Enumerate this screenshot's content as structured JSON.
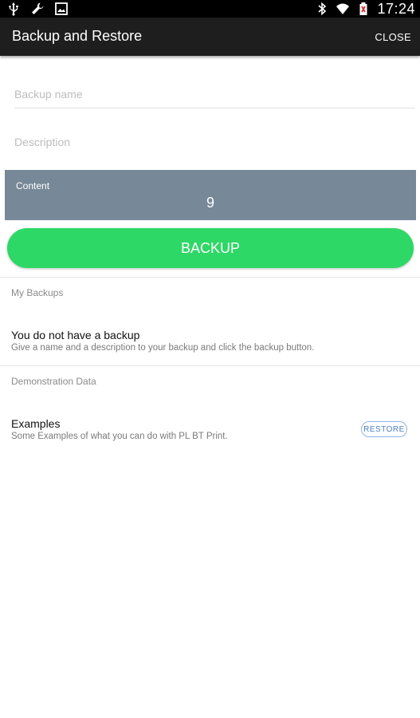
{
  "status_bar": {
    "time": "17:24",
    "left_icons": [
      "usb-icon",
      "wrench-icon",
      "image-icon"
    ],
    "right_icons": [
      "bluetooth-icon",
      "wifi-icon",
      "battery-icon"
    ]
  },
  "app_bar": {
    "title": "Backup and Restore",
    "close_label": "CLOSE"
  },
  "form": {
    "backup_name_placeholder": "Backup name",
    "description_placeholder": "Description"
  },
  "content_panel": {
    "label": "Content",
    "value": "9"
  },
  "backup_button": {
    "label": "BACKUP",
    "color": "#2ed866"
  },
  "my_backups": {
    "header": "My Backups",
    "empty_title": "You do not have a backup",
    "empty_subtitle": "Give a name and a description to your backup and click the backup button."
  },
  "demonstration": {
    "header": "Demonstration Data",
    "items": [
      {
        "title": "Examples",
        "subtitle": "Some Examples of what you can do with PL BT Print.",
        "action_label": "RESTORE"
      }
    ]
  },
  "colors": {
    "app_bar": "#1e1e1e",
    "content_panel": "#778898",
    "restore_accent": "#4a7fc1"
  }
}
